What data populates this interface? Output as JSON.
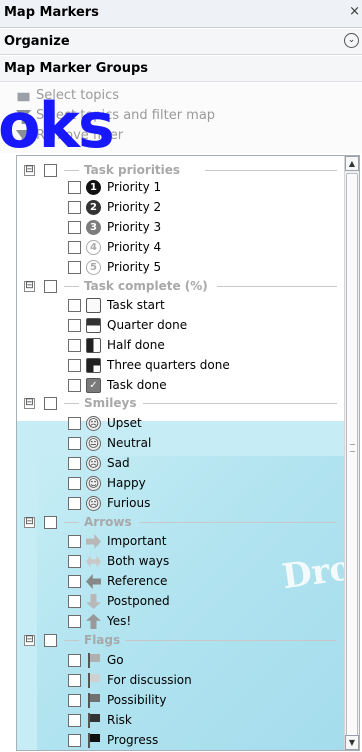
{
  "window": {
    "title": "Map Markers",
    "close_glyph": "×"
  },
  "organize": {
    "label": "Organize",
    "chevron": "⌄"
  },
  "groups_header": {
    "label": "Map Marker Groups"
  },
  "watermark": {
    "text": "oks"
  },
  "actions": [
    {
      "label": "Select topics",
      "icon": "select-topics-icon"
    },
    {
      "label": "Select topics and filter map",
      "icon": "filter-map-icon"
    },
    {
      "label": "Remove filter",
      "icon": "remove-filter-icon"
    }
  ],
  "overlay": {
    "text": "Drop"
  },
  "groups": [
    {
      "name": "Task priorities",
      "expander": "⊟",
      "items": [
        {
          "label": "Priority 1",
          "marker": "1"
        },
        {
          "label": "Priority 2",
          "marker": "2"
        },
        {
          "label": "Priority 3",
          "marker": "3"
        },
        {
          "label": "Priority 4",
          "marker": "4"
        },
        {
          "label": "Priority 5",
          "marker": "5"
        }
      ]
    },
    {
      "name": "Task complete (%)",
      "expander": "⊟",
      "items": [
        {
          "label": "Task start",
          "marker": ""
        },
        {
          "label": "Quarter done",
          "marker": ""
        },
        {
          "label": "Half done",
          "marker": ""
        },
        {
          "label": "Three quarters done",
          "marker": ""
        },
        {
          "label": "Task done",
          "marker": "✓"
        }
      ]
    },
    {
      "name": "Smileys",
      "expander": "⊟",
      "items": [
        {
          "label": "Upset",
          "marker": "☹"
        },
        {
          "label": "Neutral",
          "marker": "😐"
        },
        {
          "label": "Sad",
          "marker": "☹"
        },
        {
          "label": "Happy",
          "marker": "☺"
        },
        {
          "label": "Furious",
          "marker": "☹"
        }
      ]
    },
    {
      "name": "Arrows",
      "expander": "⊟",
      "items": [
        {
          "label": "Important",
          "marker": ""
        },
        {
          "label": "Both ways",
          "marker": ""
        },
        {
          "label": "Reference",
          "marker": ""
        },
        {
          "label": "Postponed",
          "marker": ""
        },
        {
          "label": "Yes!",
          "marker": ""
        }
      ]
    },
    {
      "name": "Flags",
      "expander": "⊟",
      "items": [
        {
          "label": "Go",
          "marker": ""
        },
        {
          "label": "For discussion",
          "marker": ""
        },
        {
          "label": "Possibility",
          "marker": ""
        },
        {
          "label": "Risk",
          "marker": ""
        },
        {
          "label": "Progress",
          "marker": ""
        }
      ]
    }
  ],
  "scrollbar": {
    "up_glyph": "▲",
    "down_glyph": "▼"
  }
}
